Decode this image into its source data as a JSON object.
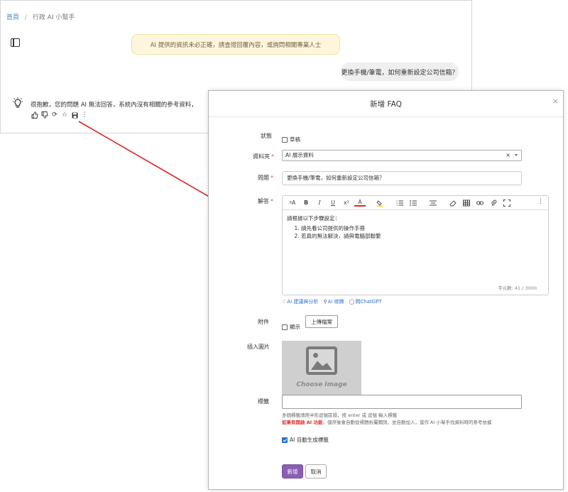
{
  "breadcrumb": {
    "home": "首頁",
    "separator": "/",
    "current": "行政 AI 小幫手"
  },
  "chat": {
    "disclaimer": "AI 提供的資訊未必正確，請查證回覆內容，或詢問相關專業人士",
    "user_message": "更換手機/筆電，如何重新設定公司信箱？",
    "bot_message": "很抱歉，您的問題 AI 無法回答，系統內沒有相關的參考資料，",
    "actions": [
      "thumbs-up-icon",
      "thumbs-down-icon",
      "refresh-icon",
      "star-icon",
      "save-icon",
      "more-vertical-icon"
    ]
  },
  "modal": {
    "title": "新增 FAQ",
    "close": "×",
    "status": {
      "label": "狀態",
      "checkbox_label": "草稿",
      "checked": false
    },
    "folder": {
      "label": "資料夾",
      "value": "AI 展示資料",
      "clear": "×"
    },
    "question": {
      "label": "問題",
      "value": "更換手機/筆電，如何重新設定公司信箱？"
    },
    "answer": {
      "label": "解答",
      "intro": "請根據以下步驟設定：",
      "steps": [
        "請先看公司提供的操作手冊",
        "若真的無法解決，請與電腦部聯繫"
      ],
      "counter": "字元數: 41 / 3000"
    },
    "ai_links": {
      "suggest": "AI 建議與分析",
      "polish": "AI 修飾",
      "ask": "問ChatGPT"
    },
    "attachment": {
      "label": "附件",
      "display_label": "顯示",
      "upload_button": "上傳檔案"
    },
    "insert_image": {
      "label": "插入圖片",
      "placeholder": "Choose Image"
    },
    "tags": {
      "label": "標籤",
      "help1": "多個標籤請用半形逗號區隔，按 enter 或 逗號 輸入標籤",
      "help2_red": "如果有開啟 AI 功能",
      "help2_rest": "，儲存後會自動從標題折屬關詞，並自動加入，當作 AI 小幫手找資料時的參考依據",
      "auto_label": "AI 自動生成標籤",
      "auto_checked": true
    },
    "buttons": {
      "submit": "新增",
      "cancel": "取消"
    }
  },
  "colors": {
    "primary": "#8a5fb0",
    "link": "#2a6fd6",
    "required": "#d9534f",
    "arrow": "#e02020"
  }
}
